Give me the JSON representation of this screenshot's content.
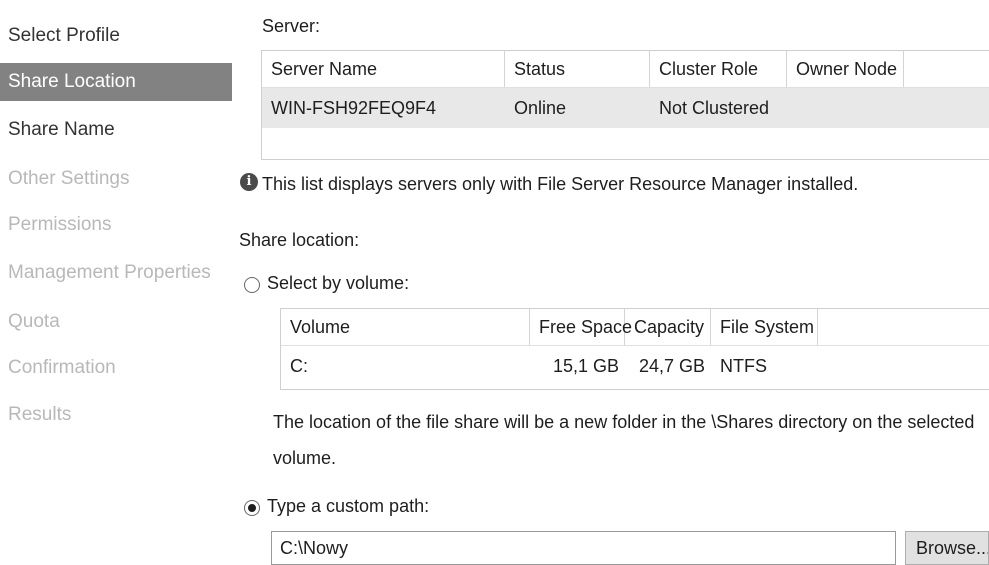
{
  "sidebar": {
    "items": [
      {
        "label": "Select Profile",
        "state": "done"
      },
      {
        "label": "Share Location",
        "state": "active"
      },
      {
        "label": "Share Name",
        "state": "done"
      },
      {
        "label": "Other Settings",
        "state": "disabled"
      },
      {
        "label": "Permissions",
        "state": "disabled"
      },
      {
        "label": "Management Properties",
        "state": "disabled"
      },
      {
        "label": "Quota",
        "state": "disabled"
      },
      {
        "label": "Confirmation",
        "state": "disabled"
      },
      {
        "label": "Results",
        "state": "disabled"
      }
    ]
  },
  "server": {
    "label": "Server:",
    "columns": [
      "Server Name",
      "Status",
      "Cluster Role",
      "Owner Node"
    ],
    "rows": [
      [
        "WIN-FSH92FEQ9F4",
        "Online",
        "Not Clustered",
        ""
      ]
    ],
    "info_text": "This list displays servers only with File Server Resource Manager installed."
  },
  "share_location": {
    "label": "Share location:",
    "by_volume": {
      "label": "Select by volume:",
      "selected": false,
      "columns": [
        "Volume",
        "Free Space",
        "Capacity",
        "File System"
      ],
      "rows": [
        [
          "C:",
          "15,1 GB",
          "24,7 GB",
          "NTFS"
        ]
      ],
      "note_line1": "The location of the file share will be a new folder in the \\Shares directory on the selected",
      "note_line2": "volume."
    },
    "custom_path": {
      "label": "Type a custom path:",
      "selected": true,
      "value": "C:\\Nowy",
      "browse_label": "Browse..."
    }
  },
  "colors": {
    "active_nav_bg": "#828282",
    "disabled_nav_text": "#b8b8b8",
    "selected_row_bg": "#e8e8e8"
  }
}
